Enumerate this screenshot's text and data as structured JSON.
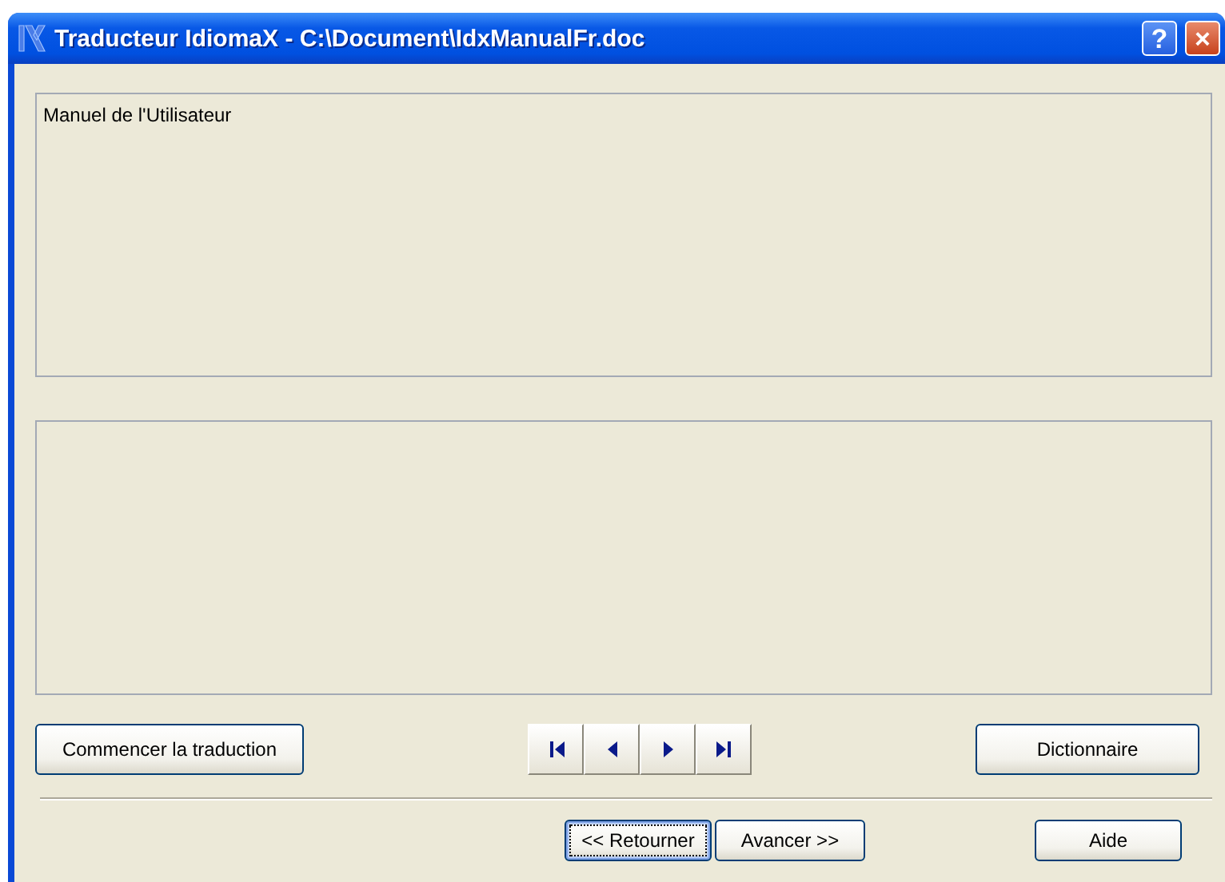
{
  "window": {
    "title": "Traducteur IdiomaX - C:\\Document\\IdxManualFr.doc",
    "help_button": "?",
    "close_button": "×"
  },
  "source_panel": {
    "text": "Manuel de l'Utilisateur"
  },
  "action_buttons": [
    {
      "label": "Commencer la traduction",
      "kind": "start"
    },
    {
      "label": "Dictionnaire",
      "kind": "dictionary"
    }
  ],
  "navigation": [
    {
      "kind": "first"
    },
    {
      "kind": "previous"
    },
    {
      "kind": "next"
    },
    {
      "kind": "last"
    }
  ],
  "footer_buttons": [
    {
      "label": "<< Retourner",
      "focused": true
    },
    {
      "label": "Avancer >>",
      "focused": false
    },
    {
      "label": "Aide",
      "focused": false
    }
  ]
}
